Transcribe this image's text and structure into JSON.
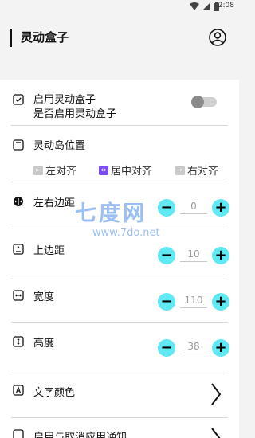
{
  "status": {
    "time": "2:08"
  },
  "app": {
    "title": "灵动盒子"
  },
  "settings": {
    "enable": {
      "title": "启用灵动盒子",
      "subtitle": "是否启用灵动盒子"
    },
    "position": {
      "label": "灵动岛位置",
      "options": [
        "左对齐",
        "居中对齐",
        "右对齐"
      ],
      "selected": "居中对齐"
    },
    "lr_margin": {
      "label": "左右边距",
      "value": "0"
    },
    "top_margin": {
      "label": "上边距",
      "value": "10"
    },
    "width": {
      "label": "宽度",
      "value": "110"
    },
    "height": {
      "label": "高度",
      "value": "38"
    },
    "text_color": {
      "label": "文字颜色"
    },
    "notify": {
      "label": "启用与取消应用通知"
    }
  },
  "watermark": {
    "logo": "七度网",
    "url": "www.7do.net"
  },
  "colors": {
    "accent": "#5fe9f2",
    "selected_align": "#7b4cf5"
  }
}
